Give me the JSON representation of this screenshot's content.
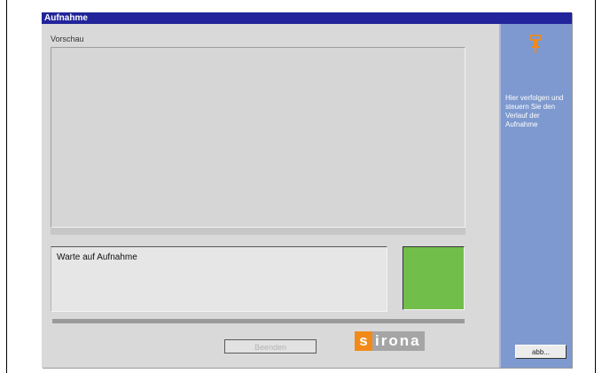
{
  "window": {
    "title": "Aufnahme"
  },
  "preview": {
    "label": "Vorschau"
  },
  "status": {
    "text": "Warte auf Aufnahme",
    "indicator_color": "#71be4b"
  },
  "buttons": {
    "finish_label": "Beenden",
    "cancel_label": "abb..."
  },
  "logo": {
    "first_letter": "s",
    "rest": "irona",
    "brand_orange": "#f28a19"
  },
  "sidebar": {
    "icon": "device-icon",
    "help_text": "Hier verfolgen und steuern Sie den Verlauf der Aufnahme",
    "background": "#7d99cf"
  },
  "colors": {
    "titlebar": "#21249a"
  }
}
